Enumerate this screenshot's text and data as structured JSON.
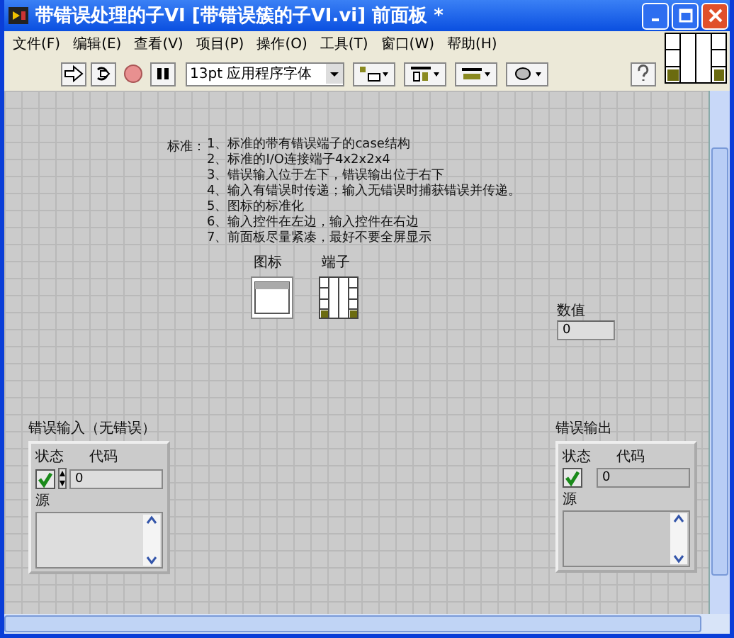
{
  "window": {
    "title": "带错误处理的子VI [带错误簇的子VI.vi] 前面板 *"
  },
  "menu": [
    "文件(F)",
    "编辑(E)",
    "查看(V)",
    "项目(P)",
    "操作(O)",
    "工具(T)",
    "窗口(W)",
    "帮助(H)"
  ],
  "toolbar": {
    "font": "13pt 应用程序字体"
  },
  "notes": {
    "label": "标准：",
    "lines": [
      "1、标准的带有错误端子的case结构",
      "2、标准的I/O连接端子4x2x2x4",
      "3、错误输入位于左下，错误输出位于右下",
      "4、输入有错误时传递；输入无错误时捕获错误并传递。",
      "5、图标的标准化",
      "6、输入控件在左边，输入控件在右边",
      "7、前面板尽量紧凑，最好不要全屏显示"
    ]
  },
  "icon_labels": [
    "图标",
    "端子"
  ],
  "numeric": {
    "label": "数值",
    "value": "0"
  },
  "clusters": [
    {
      "label": "错误输入（无错误）",
      "status_label": "状态",
      "code_label": "代码",
      "checked": true,
      "code": "0",
      "source_label": "源",
      "kind": "control"
    },
    {
      "label": "错误输出",
      "status_label": "状态",
      "code_label": "代码",
      "checked": true,
      "code": "0",
      "source_label": "源",
      "kind": "indicator"
    }
  ]
}
